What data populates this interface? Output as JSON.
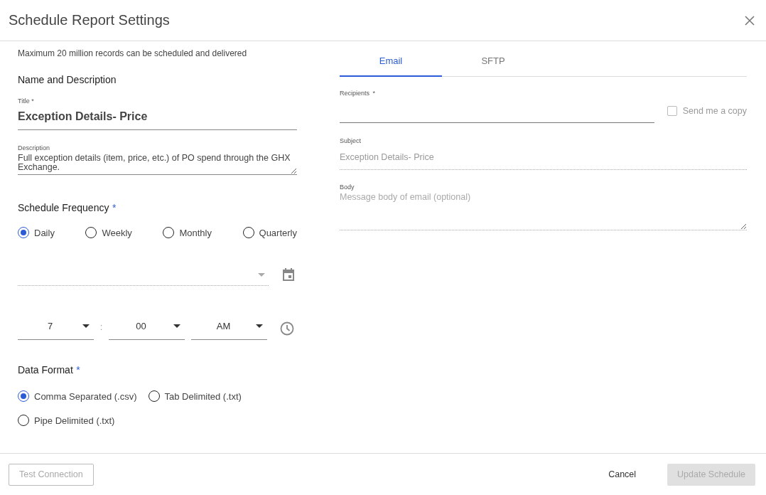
{
  "dialog": {
    "title": "Schedule Report Settings"
  },
  "notice": "Maximum 20 million records can be scheduled and delivered",
  "name_section": {
    "heading": "Name and Description",
    "title_field": {
      "label": "Title *",
      "value": "Exception Details- Price"
    },
    "description_field": {
      "label": "Description",
      "value": "Full exception details (item, price, etc.) of PO spend through the GHX Exchange."
    }
  },
  "frequency": {
    "heading": "Schedule Frequency",
    "required_mark": "*",
    "options": [
      {
        "label": "Daily",
        "selected": true
      },
      {
        "label": "Weekly",
        "selected": false
      },
      {
        "label": "Monthly",
        "selected": false
      },
      {
        "label": "Quarterly",
        "selected": false
      }
    ]
  },
  "time": {
    "hour": "7",
    "separator": ":",
    "minute": "00",
    "period": "AM"
  },
  "data_format": {
    "heading": "Data Format",
    "required_mark": "*",
    "options": [
      {
        "label": "Comma Separated (.csv)",
        "selected": true
      },
      {
        "label": "Tab Delimited (.txt)",
        "selected": false
      },
      {
        "label": "Pipe Delimited (.txt)",
        "selected": false
      }
    ]
  },
  "delivery_tabs": [
    {
      "label": "Email",
      "selected": true
    },
    {
      "label": "SFTP",
      "selected": false
    }
  ],
  "email": {
    "recipients": {
      "label": "Recipients",
      "required_mark": "*"
    },
    "send_copy": {
      "label": "Send me a copy",
      "checked": false,
      "disabled": true
    },
    "subject": {
      "label": "Subject",
      "value": "Exception Details- Price",
      "disabled": true
    },
    "body": {
      "label": "Body",
      "placeholder": "Message body of email (optional)"
    }
  },
  "footer": {
    "buttons": [
      {
        "label": "Test Connection",
        "kind": "outlined",
        "disabled": true
      },
      {
        "label": "Cancel",
        "kind": "text",
        "disabled": false
      },
      {
        "label": "Update Schedule",
        "kind": "filled",
        "disabled": true
      }
    ]
  }
}
